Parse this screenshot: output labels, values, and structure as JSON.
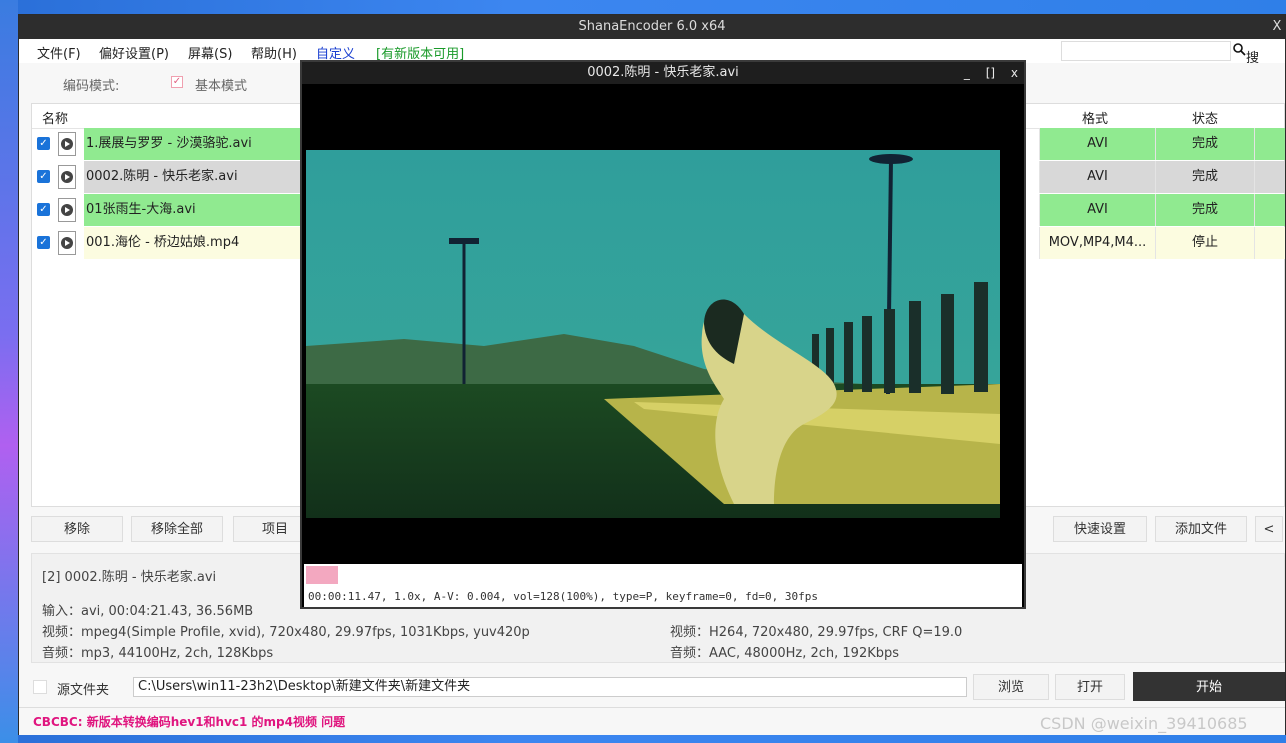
{
  "window": {
    "title": "ShanaEncoder 6.0 x64",
    "close": "X"
  },
  "menu": {
    "file": "文件(F)",
    "prefs": "偏好设置(P)",
    "screen": "屏幕(S)",
    "help": "帮助(H)",
    "custom": "自定义",
    "update": "[有新版本可用]",
    "search_label": "搜索"
  },
  "mode": {
    "label": "编码模式:",
    "basic": "基本模式"
  },
  "list": {
    "headers": {
      "name": "名称",
      "format": "格式",
      "status": "状态"
    },
    "rows": [
      {
        "name": "1.展展与罗罗 - 沙漠骆驼.avi",
        "format": "AVI",
        "status": "完成",
        "color": "#90ea90"
      },
      {
        "name": "0002.陈明 - 快乐老家.avi",
        "format": "AVI",
        "status": "完成",
        "color": "#d8d8d8"
      },
      {
        "name": "01张雨生-大海.avi",
        "format": "AVI",
        "status": "完成",
        "color": "#90ea90"
      },
      {
        "name": "001.海伦 - 桥边姑娘.mp4",
        "format": "MOV,MP4,M4...",
        "status": "停止",
        "color": "#fcfce0"
      }
    ]
  },
  "buttons": {
    "remove": "移除",
    "remove_all": "移除全部",
    "item": "项目",
    "quick_settings": "快速设置",
    "add_file": "添加文件",
    "collapse": "<"
  },
  "info": {
    "file": "[2] 0002.陈明 - 快乐老家.avi",
    "input": "输入：avi, 00:04:21.43, 36.56MB",
    "video_in": "视频：mpeg4(Simple Profile, xvid), 720x480, 29.97fps, 1031Kbps,  yuv420p",
    "audio_in": "音频：mp3, 44100Hz, 2ch, 128Kbps",
    "video_out": "视频：H264, 720x480, 29.97fps, CRF Q=19.0",
    "audio_out": "音频：AAC, 48000Hz, 2ch, 192Kbps"
  },
  "bottom": {
    "source_folder": "源文件夹",
    "path": "C:\\Users\\win11-23h2\\Desktop\\新建文件夹\\新建文件夹",
    "browse": "浏览",
    "open": "打开",
    "start": "开始"
  },
  "statusbar": {
    "message": "CBCBC: 新版本转换编码hev1和hvc1 的mp4视频 问题"
  },
  "preview": {
    "title": "0002.陈明 - 快乐老家.avi",
    "ctrl_min": "_",
    "ctrl_max": "[]",
    "ctrl_close": "x",
    "progress": 0.044,
    "osd": "00:00:11.47, 1.0x, A-V:  0.004, vol=128(100%), type=P, keyframe=0, fd=0, 30fps"
  },
  "watermark": "CSDN @weixin_39410685",
  "colors": {
    "accent_pink": "#e0157f",
    "start_button": "#333333",
    "complete_green": "#90ea90"
  }
}
